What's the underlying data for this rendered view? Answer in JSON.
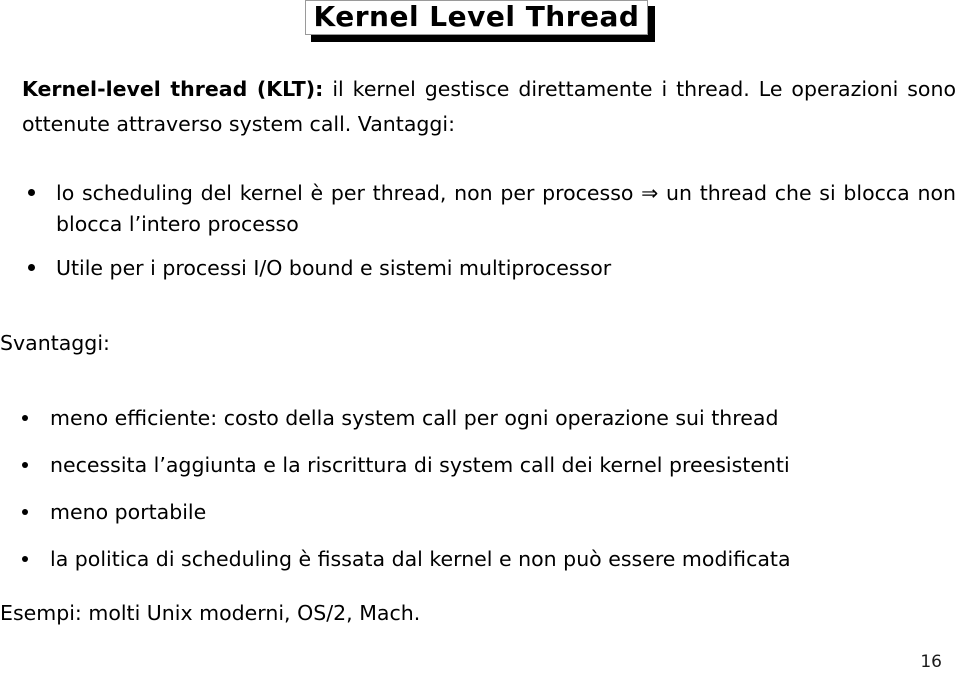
{
  "slide": {
    "title": "Kernel Level Thread",
    "page_number": "16",
    "intro": {
      "lead": "Kernel-level thread (KLT):",
      "rest": " il kernel gestisce direttamente i thread. Le operazioni sono ottenute attraverso system call. Vantaggi:"
    },
    "vantaggi": {
      "items": [
        "lo scheduling del kernel è per thread, non per processo ⇒ un thread che si blocca non blocca l’intero processo",
        "Utile per i processi I/O bound e sistemi multiprocessor"
      ]
    },
    "svantaggi": {
      "heading": "Svantaggi:",
      "items": [
        "meno efficiente: costo della system call per ogni operazione sui thread",
        "necessita l’aggiunta e la riscrittura di system call dei kernel preesistenti",
        "meno portabile",
        "la politica di scheduling è fissata dal kernel e non può essere modificata"
      ]
    },
    "esempi": "Esempi: molti Unix moderni, OS/2, Mach.",
    "colors": {
      "text": "#000000",
      "background": "#ffffff",
      "title_border": "#9a9a9a",
      "title_shadow": "#000000"
    }
  }
}
